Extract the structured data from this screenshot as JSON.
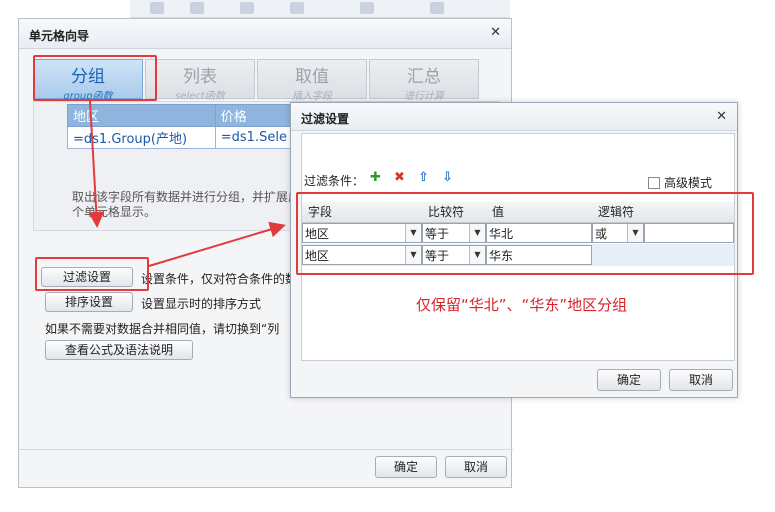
{
  "main_dialog": {
    "title": "单元格向导",
    "tabs": [
      {
        "label": "分组",
        "sub": "group函数",
        "active": true
      },
      {
        "label": "列表",
        "sub": "select函数",
        "active": false
      },
      {
        "label": "取值",
        "sub": "插入字段",
        "active": false
      },
      {
        "label": "汇总",
        "sub": "进行计算",
        "active": false
      }
    ],
    "preview_table": {
      "headers": [
        "地区",
        "价格"
      ],
      "cells": [
        "=ds1.Group(产地)",
        "=ds1.Sele"
      ]
    },
    "description": "取出该字段所有数据并进行分组，并扩展成多个单元格显示。",
    "filter_button": "过滤设置",
    "filter_desc": "设置条件，仅对符合条件的数",
    "sort_button": "排序设置",
    "sort_desc": "设置显示时的排序方式",
    "merge_hint": "如果不需要对数据合并相同值，请切换到“列",
    "formula_button": "查看公式及语法说明",
    "ok_button": "确定",
    "cancel_button": "取消"
  },
  "filter_dialog": {
    "title": "过滤设置",
    "condition_label": "过滤条件：",
    "advanced_mode": "高级模式",
    "columns": [
      "字段",
      "比较符",
      "值",
      "逻辑符"
    ],
    "rows": [
      {
        "field": "地区",
        "op": "等于",
        "value": "华北",
        "logic": "或"
      },
      {
        "field": "地区",
        "op": "等于",
        "value": "华东",
        "logic": ""
      }
    ],
    "ok_button": "确定",
    "cancel_button": "取消"
  },
  "annotation": "仅保留“华北”、“华东”地区分组",
  "colors": {
    "highlight": "#e23b3b",
    "tab_active": "#1b62b5"
  }
}
